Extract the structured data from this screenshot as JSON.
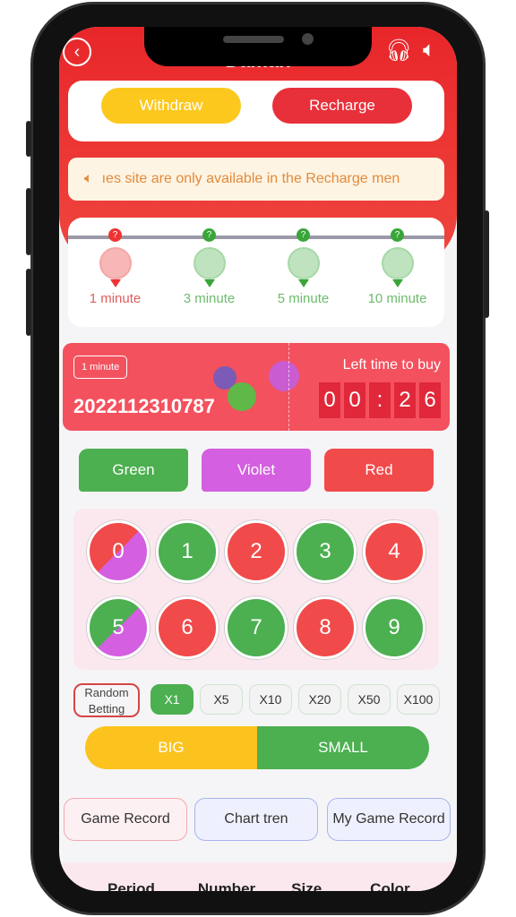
{
  "header": {
    "title": "Daman",
    "back_icon": "chevron-left-circle-icon",
    "support_icon": "headset-icon",
    "sound_icon": "speaker-icon"
  },
  "wallet": {
    "withdraw": "Withdraw",
    "recharge": "Recharge"
  },
  "notice": {
    "text": "ıes site are only available in the Recharge men",
    "icon": "speaker-icon"
  },
  "timers": [
    {
      "label": "1 minute",
      "active": true
    },
    {
      "label": "3 minute",
      "active": false
    },
    {
      "label": "5 minute",
      "active": false
    },
    {
      "label": "10 minute",
      "active": false
    }
  ],
  "round": {
    "badge": "1 minute",
    "period": "2022112310787",
    "left_label": "Left time to buy",
    "digits": [
      "0",
      "0",
      ":",
      "2",
      "6"
    ]
  },
  "colors": {
    "green": "Green",
    "violet": "Violet",
    "red": "Red",
    "green_hex": "#4caf50",
    "violet_hex": "#d45fe0",
    "red_hex": "#f14a4a"
  },
  "numbers": [
    "0",
    "1",
    "2",
    "3",
    "4",
    "5",
    "6",
    "7",
    "8",
    "9"
  ],
  "random": "Random Betting",
  "multipliers": [
    "X1",
    "X5",
    "X10",
    "X20",
    "X50",
    "X100"
  ],
  "selected_multiplier": "X1",
  "size": {
    "big": "BIG",
    "small": "SMALL"
  },
  "records": {
    "game": "Game Record",
    "chart": "Chart tren",
    "mine": "My Game Record"
  },
  "table_headers": [
    "Period",
    "Number",
    "Size",
    "Color"
  ]
}
